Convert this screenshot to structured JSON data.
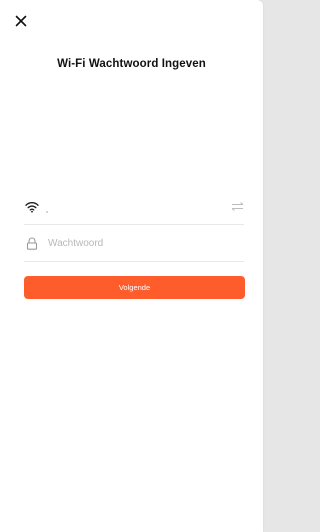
{
  "header": {
    "close_icon": "close-icon",
    "title": "Wi-Fi Wachtwoord Ingeven"
  },
  "form": {
    "wifi": {
      "icon": "wifi-icon",
      "ssid_value": "",
      "swap_icon": "swap-arrows-icon"
    },
    "password": {
      "icon": "lock-icon",
      "placeholder": "Wachtwoord",
      "value": ""
    },
    "next_button_label": "Volgende"
  },
  "colors": {
    "accent": "#ff5c2b",
    "title": "#111111",
    "placeholder": "#b8b8b8",
    "divider": "#e8e8e8"
  }
}
